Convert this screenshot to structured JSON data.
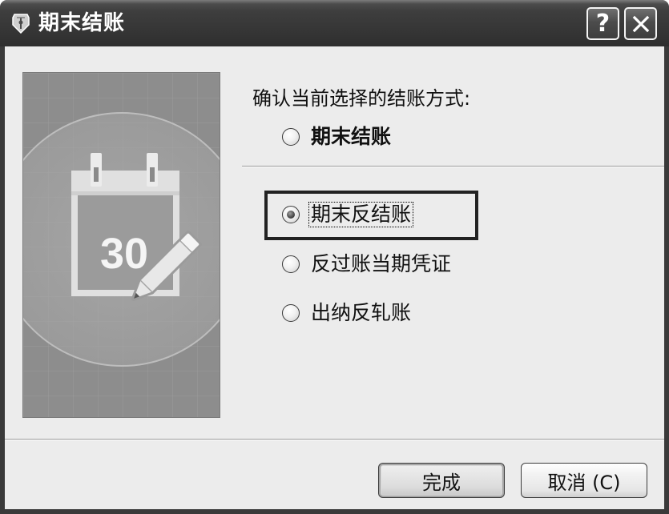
{
  "window": {
    "title": "期末结账",
    "title_icon": "app-icon",
    "help_label": "?",
    "close_icon": "close-icon"
  },
  "prompt": "确认当前选择的结账方式:",
  "options": [
    {
      "label": "期末结账",
      "selected": false,
      "bold": true
    },
    {
      "label": "期末反结账",
      "selected": true,
      "focused": true,
      "highlighted": true
    },
    {
      "label": "反过账当期凭证",
      "selected": false
    },
    {
      "label": "出纳反轧账",
      "selected": false
    }
  ],
  "illustration": {
    "icon": "calendar-edit-icon",
    "calendar_day": "30"
  },
  "footer": {
    "finish_label": "完成",
    "cancel_label": "取消 (C)"
  },
  "colors": {
    "title_bar": "#3a3a3a",
    "client": "#ececec",
    "highlight_box": "#222222"
  }
}
